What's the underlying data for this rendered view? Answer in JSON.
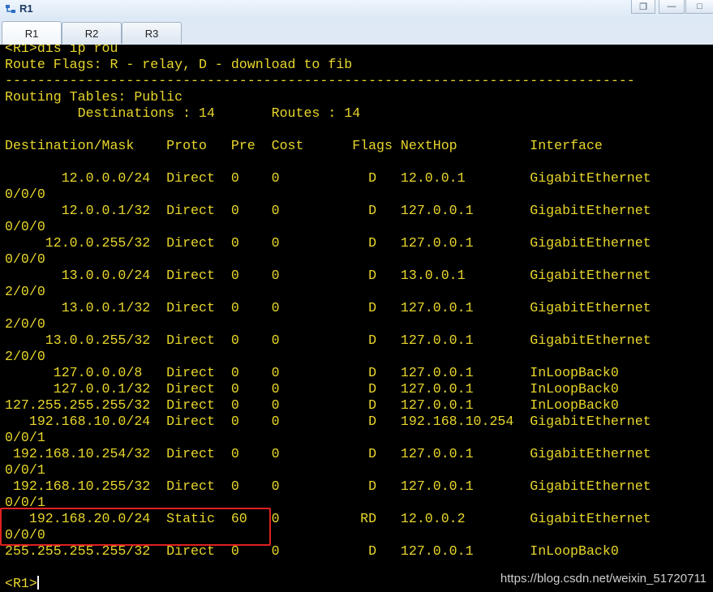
{
  "window": {
    "title": "R1",
    "restore_glyph": "❐",
    "minimize_glyph": "—",
    "maximize_glyph": "□"
  },
  "tabs": [
    {
      "label": "R1",
      "active": true
    },
    {
      "label": "R2",
      "active": false
    },
    {
      "label": "R3",
      "active": false
    }
  ],
  "terminal": {
    "text_color": "#e8d62c",
    "background": "#000000",
    "highlight_color": "#e02020",
    "lines": [
      "<R1>dis ip rou",
      "Route Flags: R - relay, D - download to fib",
      "------------------------------------------------------------------------------",
      "Routing Tables: Public",
      "         Destinations : 14       Routes : 14",
      "",
      "Destination/Mask    Proto   Pre  Cost      Flags NextHop         Interface",
      "",
      "       12.0.0.0/24  Direct  0    0           D   12.0.0.1        GigabitEthernet",
      "0/0/0",
      "       12.0.0.1/32  Direct  0    0           D   127.0.0.1       GigabitEthernet",
      "0/0/0",
      "     12.0.0.255/32  Direct  0    0           D   127.0.0.1       GigabitEthernet",
      "0/0/0",
      "       13.0.0.0/24  Direct  0    0           D   13.0.0.1        GigabitEthernet",
      "2/0/0",
      "       13.0.0.1/32  Direct  0    0           D   127.0.0.1       GigabitEthernet",
      "2/0/0",
      "     13.0.0.255/32  Direct  0    0           D   127.0.0.1       GigabitEthernet",
      "2/0/0",
      "      127.0.0.0/8   Direct  0    0           D   127.0.0.1       InLoopBack0",
      "      127.0.0.1/32  Direct  0    0           D   127.0.0.1       InLoopBack0",
      "127.255.255.255/32  Direct  0    0           D   127.0.0.1       InLoopBack0",
      "   192.168.10.0/24  Direct  0    0           D   192.168.10.254  GigabitEthernet",
      "0/0/1",
      " 192.168.10.254/32  Direct  0    0           D   127.0.0.1       GigabitEthernet",
      "0/0/1",
      " 192.168.10.255/32  Direct  0    0           D   127.0.0.1       GigabitEthernet",
      "0/0/1",
      "   192.168.20.0/24  Static  60   0          RD   12.0.0.2        GigabitEthernet",
      "0/0/0",
      "255.255.255.255/32  Direct  0    0           D   127.0.0.1       InLoopBack0",
      ""
    ],
    "prompt": "<R1>"
  },
  "watermark": "https://blog.csdn.net/weixin_51720711"
}
